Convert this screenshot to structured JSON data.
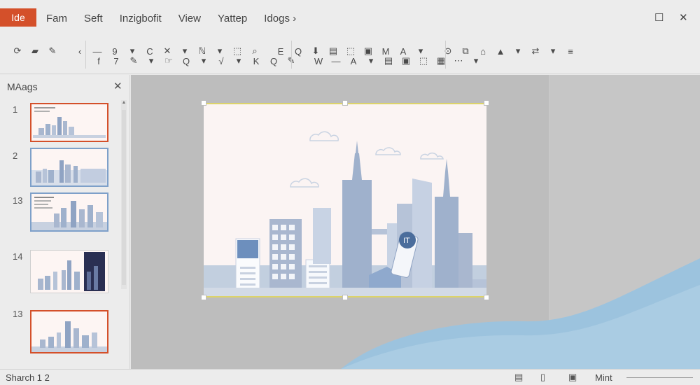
{
  "app": {
    "file_tab": "Ide",
    "menu": [
      "Fam",
      "Seft",
      "Inzigbofit",
      "View",
      "Yattep",
      "Idogs ›"
    ],
    "window_controls": {
      "maximize": "☐",
      "close": "✕"
    }
  },
  "ribbon": {
    "row1": [
      "⟳",
      "▰",
      "✎",
      "‹",
      "—",
      "9",
      "▾",
      "C",
      "✕",
      "▾",
      "ℕ",
      "▾",
      "⬚",
      "⌕",
      "E",
      "Q",
      "⬇",
      "▤",
      "⬚",
      "▣",
      "M",
      "A",
      "▾",
      "⊙",
      "⧉",
      "⌂",
      "▲",
      "▾",
      "⇄",
      "▾",
      "≡"
    ],
    "row2": [
      "f",
      "7",
      "✎",
      "▾",
      "☞",
      "Q",
      "▾",
      "√",
      "▾",
      "K",
      "Q",
      "✎",
      "W",
      "—",
      "A",
      "▾",
      "▤",
      "▣",
      "⬚",
      "▦",
      "⋯",
      "▾"
    ]
  },
  "pane": {
    "title": "MAags",
    "close": "✕",
    "slide_numbers": [
      "1",
      "2",
      "13",
      "14",
      "13"
    ]
  },
  "status": {
    "left": "Sharch 1  2",
    "right": "Mint"
  },
  "colors": {
    "file_tab": "#d4502a",
    "slide_bg": "#fbf4f3",
    "building": "#9fb1cc",
    "selection": "#dcd36a",
    "wave": "#9cc3de"
  }
}
